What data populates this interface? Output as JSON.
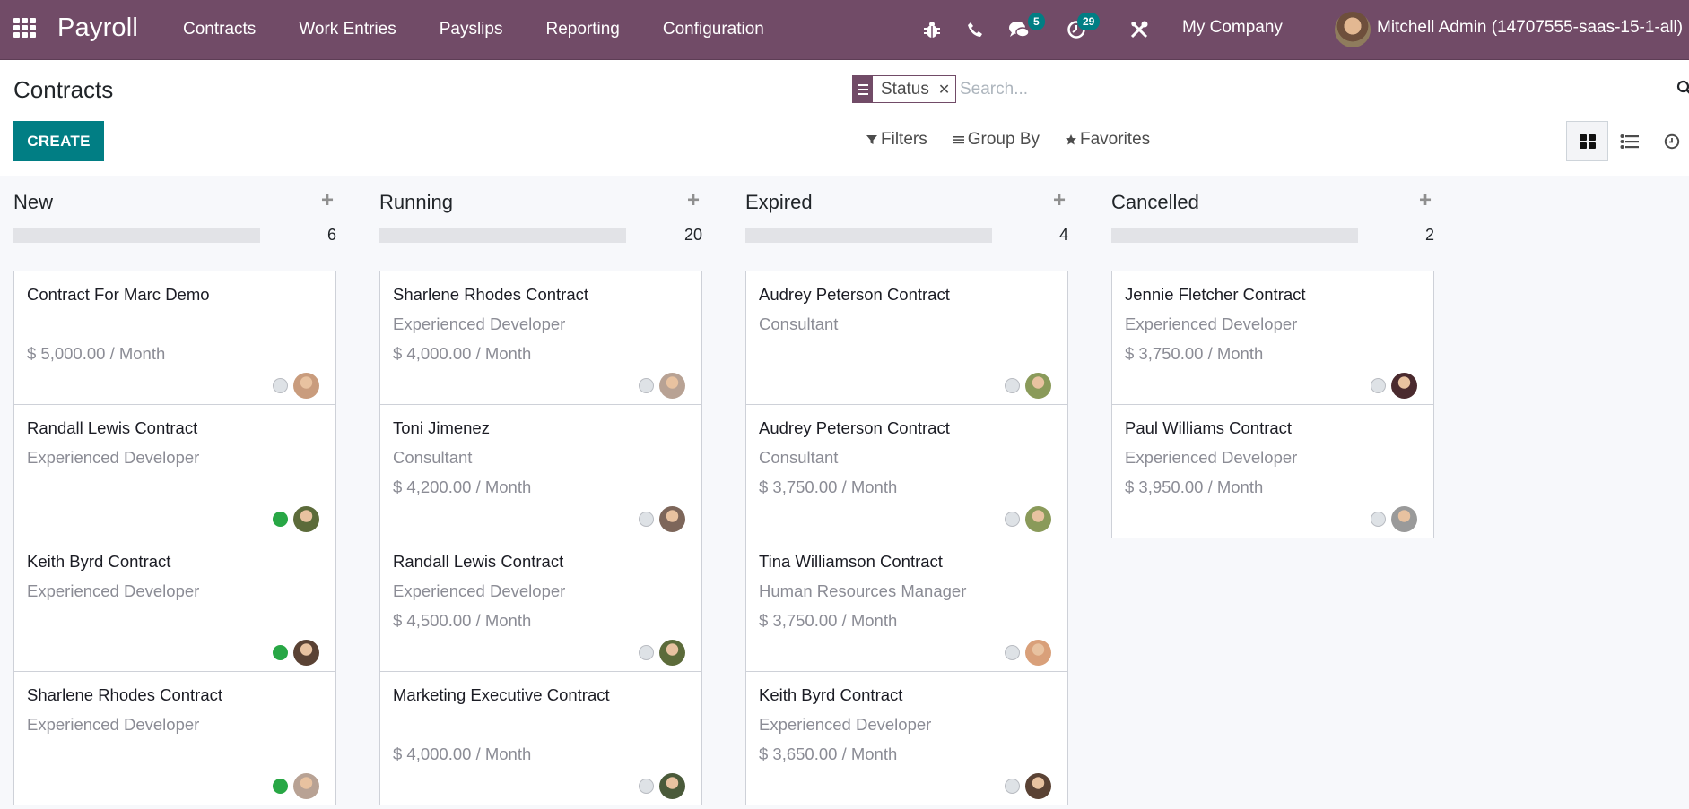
{
  "navbar": {
    "app_name": "Payroll",
    "menu": [
      "Contracts",
      "Work Entries",
      "Payslips",
      "Reporting",
      "Configuration"
    ],
    "icons": {
      "apps": "apps-grid-icon",
      "debug": "bug-icon",
      "phone": "phone-icon",
      "messages": "chat-icon",
      "activities": "clock-icon",
      "tools": "tools-icon"
    },
    "messages_count": "5",
    "activities_count": "29",
    "company": "My Company",
    "user": "Mitchell Admin (14707555-saas-15-1-all)",
    "color": "#714b67"
  },
  "control_panel": {
    "title": "Contracts",
    "create_label": "CREATE",
    "search": {
      "facet_label": "Status",
      "placeholder": "Search..."
    },
    "filters_label": "Filters",
    "group_by_label": "Group By",
    "favorites_label": "Favorites",
    "views": [
      "kanban",
      "list",
      "activity"
    ],
    "active_view": "kanban",
    "accent": "#017e84"
  },
  "columns": [
    {
      "title": "New",
      "count": "6",
      "cards": [
        {
          "title": "Contract For Marc Demo",
          "job": "",
          "wage": "$ 5,000.00 / Month",
          "state": "normal",
          "avatar": "#c99c7d"
        },
        {
          "title": "Randall Lewis Contract",
          "job": "Experienced Developer",
          "wage": "",
          "state": "done",
          "avatar": "#5c6b3a"
        },
        {
          "title": "Keith Byrd Contract",
          "job": "Experienced Developer",
          "wage": "",
          "state": "done",
          "avatar": "#5a4234"
        },
        {
          "title": "Sharlene Rhodes Contract",
          "job": "Experienced Developer",
          "wage": "",
          "state": "done",
          "avatar": "#b8a294"
        }
      ]
    },
    {
      "title": "Running",
      "count": "20",
      "cards": [
        {
          "title": "Sharlene Rhodes Contract",
          "job": "Experienced Developer",
          "wage": "$ 4,000.00 / Month",
          "state": "normal",
          "avatar": "#b8a294"
        },
        {
          "title": "Toni Jimenez",
          "job": "Consultant",
          "wage": "$ 4,200.00 / Month",
          "state": "normal",
          "avatar": "#7d665a"
        },
        {
          "title": "Randall Lewis Contract",
          "job": "Experienced Developer",
          "wage": "$ 4,500.00 / Month",
          "state": "normal",
          "avatar": "#5c6b3a"
        },
        {
          "title": "Marketing Executive Contract",
          "job": "",
          "wage": "$ 4,000.00 / Month",
          "state": "normal",
          "avatar": "#4a5a3a"
        }
      ]
    },
    {
      "title": "Expired",
      "count": "4",
      "cards": [
        {
          "title": "Audrey Peterson Contract",
          "job": "Consultant",
          "wage": "",
          "state": "normal",
          "avatar": "#8a9a5a"
        },
        {
          "title": "Audrey Peterson Contract",
          "job": "Consultant",
          "wage": "$ 3,750.00 / Month",
          "state": "normal",
          "avatar": "#8a9a5a"
        },
        {
          "title": "Tina Williamson Contract",
          "job": "Human Resources Manager",
          "wage": "$ 3,750.00 / Month",
          "state": "normal",
          "avatar": "#d9a07a"
        },
        {
          "title": "Keith Byrd Contract",
          "job": "Experienced Developer",
          "wage": "$ 3,650.00 / Month",
          "state": "normal",
          "avatar": "#5a4234"
        }
      ]
    },
    {
      "title": "Cancelled",
      "count": "2",
      "cards": [
        {
          "title": "Jennie Fletcher Contract",
          "job": "Experienced Developer",
          "wage": "$ 3,750.00 / Month",
          "state": "normal",
          "avatar": "#4a2a2e"
        },
        {
          "title": "Paul Williams Contract",
          "job": "Experienced Developer",
          "wage": "$ 3,950.00 / Month",
          "state": "normal",
          "avatar": "#9a9a9a"
        }
      ]
    }
  ]
}
